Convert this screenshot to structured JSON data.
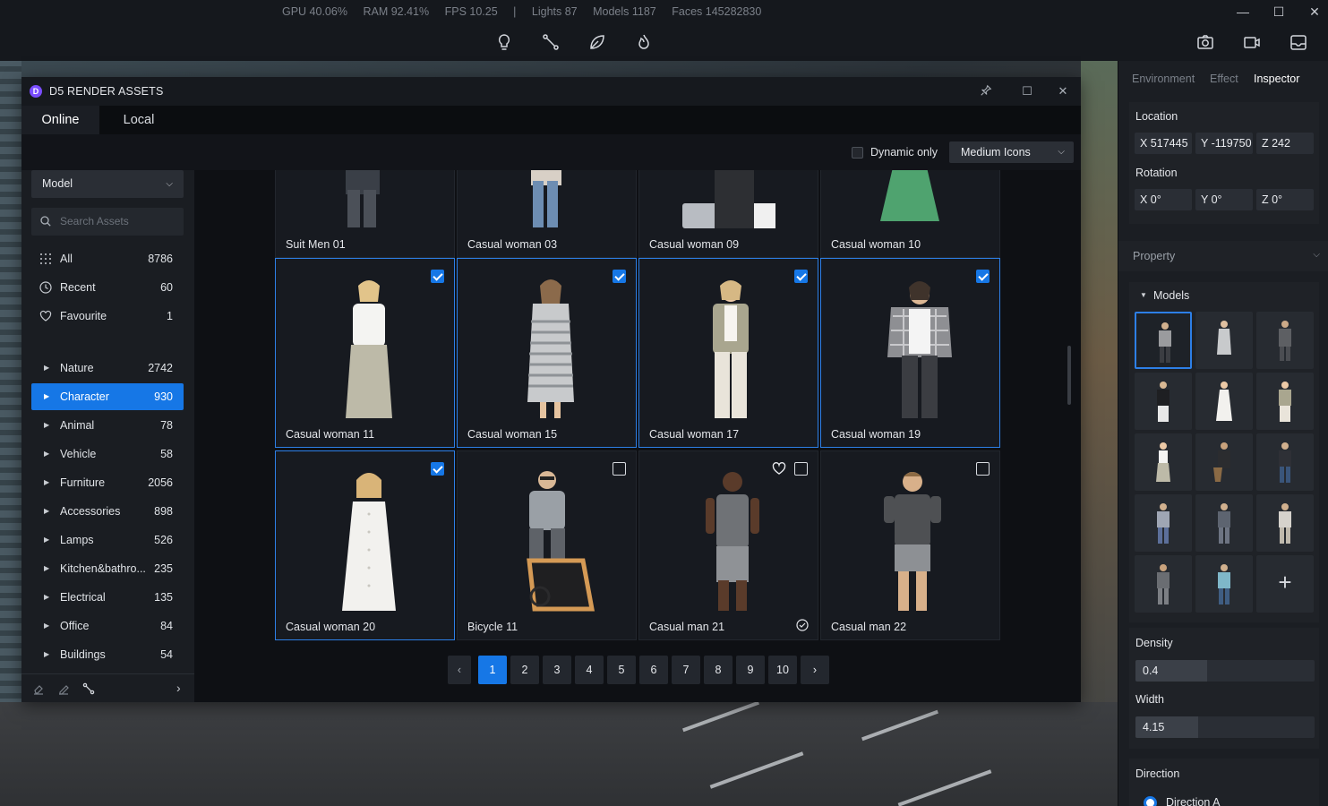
{
  "status": {
    "gpu": "GPU 40.06%",
    "ram": "RAM 92.41%",
    "fps": "FPS 10.25",
    "sep": "|",
    "lights": "Lights 87",
    "models": "Models 1187",
    "faces": "Faces 145282830"
  },
  "toolbar": {
    "tools": [
      "lightbulb-icon",
      "path-icon",
      "leaf-icon",
      "fire-icon"
    ],
    "right_tools": [
      "camera-icon",
      "video-icon",
      "gallery-icon"
    ]
  },
  "window_controls": {
    "minimize": "—",
    "maximize": "☐",
    "close": "✕"
  },
  "assets": {
    "title": "D5 RENDER ASSETS",
    "tabs": [
      {
        "label": "Online"
      },
      {
        "label": "Local"
      }
    ],
    "dynamic_only": "Dynamic only",
    "icon_size": "Medium Icons",
    "model_select": "Model",
    "search_placeholder": "Search Assets",
    "quick": [
      {
        "label": "All",
        "count": "8786"
      },
      {
        "label": "Recent",
        "count": "60"
      },
      {
        "label": "Favourite",
        "count": "1"
      }
    ],
    "categories": [
      {
        "label": "Nature",
        "count": "2742"
      },
      {
        "label": "Character",
        "count": "930"
      },
      {
        "label": "Animal",
        "count": "78"
      },
      {
        "label": "Vehicle",
        "count": "58"
      },
      {
        "label": "Furniture",
        "count": "2056"
      },
      {
        "label": "Accessories",
        "count": "898"
      },
      {
        "label": "Lamps",
        "count": "526"
      },
      {
        "label": "Kitchen&bathro...",
        "count": "235"
      },
      {
        "label": "Electrical",
        "count": "135"
      },
      {
        "label": "Office",
        "count": "84"
      },
      {
        "label": "Buildings",
        "count": "54"
      }
    ],
    "selected_category": "Character",
    "cards": [
      {
        "name": "Suit Men 01",
        "selected": false,
        "checkbox": false
      },
      {
        "name": "Casual woman 03",
        "selected": false,
        "checkbox": false
      },
      {
        "name": "Casual woman 09",
        "selected": false,
        "checkbox": false
      },
      {
        "name": "Casual woman 10",
        "selected": false,
        "checkbox": false
      },
      {
        "name": "Casual woman 11",
        "selected": true,
        "checkbox": true
      },
      {
        "name": "Casual woman 15",
        "selected": true,
        "checkbox": true
      },
      {
        "name": "Casual woman 17",
        "selected": true,
        "checkbox": true
      },
      {
        "name": "Casual woman 19",
        "selected": true,
        "checkbox": true
      },
      {
        "name": "Casual woman 20",
        "selected": true,
        "checkbox": true
      },
      {
        "name": "Bicycle 11",
        "selected": false,
        "checkbox": true
      },
      {
        "name": "Casual man 21",
        "selected": false,
        "checkbox": true
      },
      {
        "name": "Casual man 22",
        "selected": false,
        "checkbox": true
      }
    ],
    "pages": [
      "1",
      "2",
      "3",
      "4",
      "5",
      "6",
      "7",
      "8",
      "9",
      "10"
    ],
    "current_page": "1",
    "prev": "‹",
    "next": "›"
  },
  "inspector": {
    "tabs": [
      "Environment",
      "Effect",
      "Inspector"
    ],
    "active_tab": "Inspector",
    "location_label": "Location",
    "location": {
      "x": "X 517445",
      "y": "Y -119750",
      "z": "Z 242"
    },
    "rotation_label": "Rotation",
    "rotation": {
      "x": "X 0°",
      "y": "Y 0°",
      "z": "Z 0°"
    },
    "property_label": "Property",
    "models_label": "Models",
    "add_label": "+",
    "density_label": "Density",
    "density_value": "0.4",
    "density_fraction": 0.4,
    "width_label": "Width",
    "width_value": "4.15",
    "width_fraction": 0.35,
    "direction_label": "Direction",
    "direction_option": "Direction A"
  }
}
